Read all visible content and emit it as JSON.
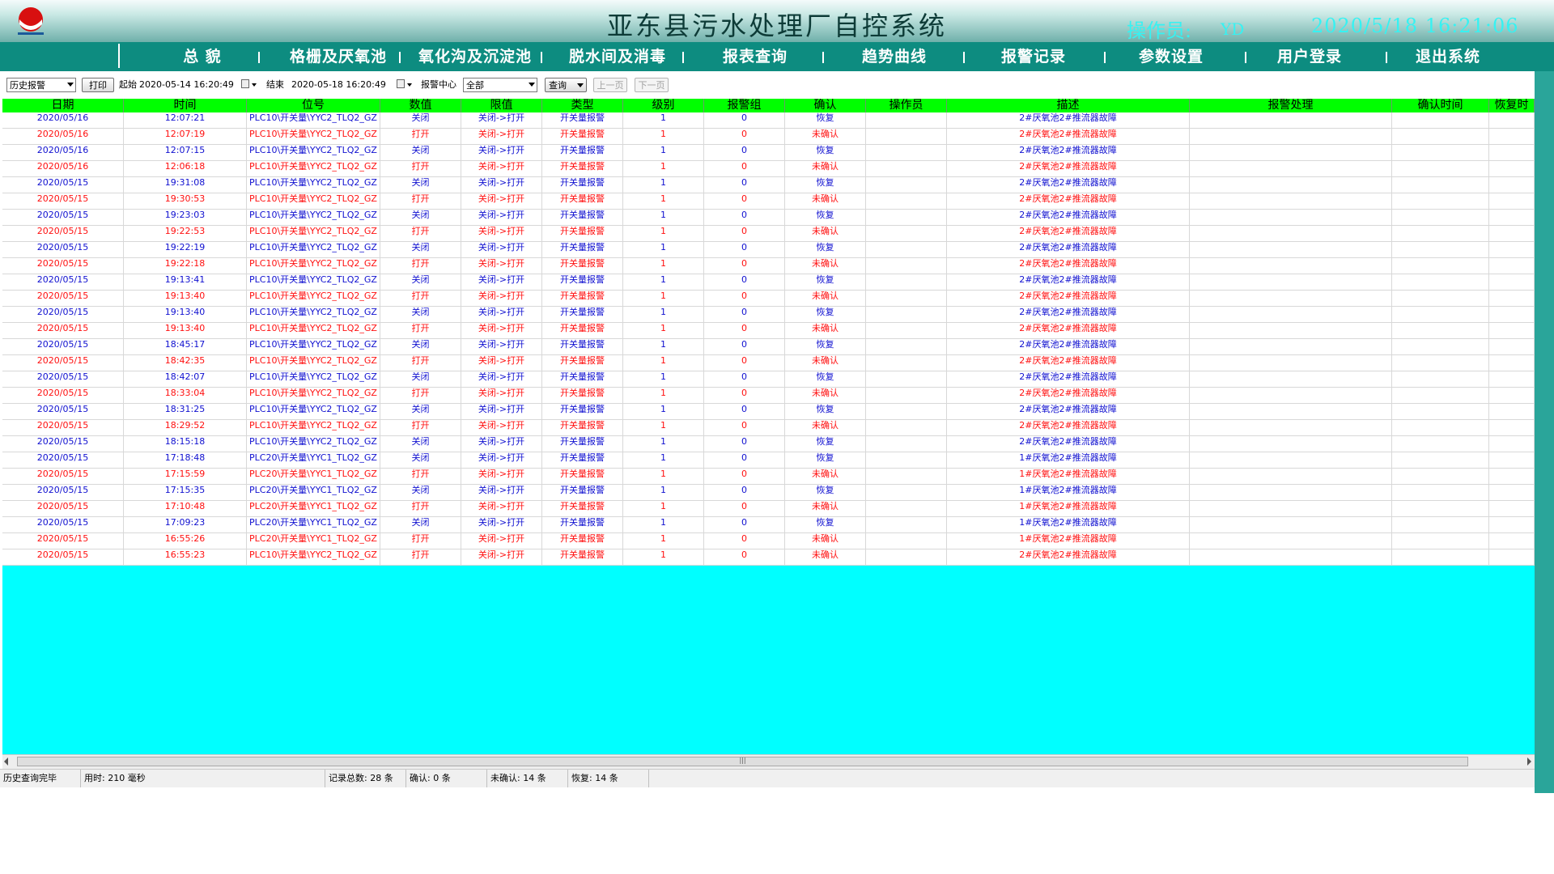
{
  "header": {
    "title": "亚东县污水处理厂自控系统",
    "operator_label": "操作员:",
    "operator": "YD",
    "datetime": "2020/5/18 16:21:06"
  },
  "nav": [
    {
      "label": "总  貌"
    },
    {
      "label": "格栅及厌氧池"
    },
    {
      "label": "氧化沟及沉淀池"
    },
    {
      "label": "脱水间及消毒"
    },
    {
      "label": "报表查询"
    },
    {
      "label": "趋势曲线"
    },
    {
      "label": "报警记录"
    },
    {
      "label": "参数设置"
    },
    {
      "label": "用户登录"
    },
    {
      "label": "退出系统"
    }
  ],
  "toolbar": {
    "mode": "历史报警",
    "print": "打印",
    "start_label": "起始",
    "start_value": "2020-05-14 16:20:49",
    "end_label": "结束",
    "end_value": "2020-05-18 16:20:49",
    "center_label": "报警中心",
    "center_value": "全部",
    "query": "查询",
    "prev": "上一页",
    "next": "下一页"
  },
  "table": {
    "headers": [
      "日期",
      "时间",
      "位号",
      "数值",
      "限值",
      "类型",
      "级别",
      "报警组",
      "确认",
      "操作员",
      "描述",
      "报警处理",
      "确认时间",
      "恢复时"
    ],
    "rows": [
      {
        "c": "blue",
        "d": "2020/05/16",
        "t": "12:07:21",
        "tag": "PLC10\\开关量\\YYC2_TLQ2_GZ",
        "v": "关闭",
        "lim": "关闭->打开",
        "type": "开关量报警",
        "lv": "1",
        "grp": "0",
        "ack": "恢复",
        "desc": "2#厌氧池2#推流器故障"
      },
      {
        "c": "red",
        "d": "2020/05/16",
        "t": "12:07:19",
        "tag": "PLC10\\开关量\\YYC2_TLQ2_GZ",
        "v": "打开",
        "lim": "关闭->打开",
        "type": "开关量报警",
        "lv": "1",
        "grp": "0",
        "ack": "未确认",
        "desc": "2#厌氧池2#推流器故障"
      },
      {
        "c": "blue",
        "d": "2020/05/16",
        "t": "12:07:15",
        "tag": "PLC10\\开关量\\YYC2_TLQ2_GZ",
        "v": "关闭",
        "lim": "关闭->打开",
        "type": "开关量报警",
        "lv": "1",
        "grp": "0",
        "ack": "恢复",
        "desc": "2#厌氧池2#推流器故障"
      },
      {
        "c": "red",
        "d": "2020/05/16",
        "t": "12:06:18",
        "tag": "PLC10\\开关量\\YYC2_TLQ2_GZ",
        "v": "打开",
        "lim": "关闭->打开",
        "type": "开关量报警",
        "lv": "1",
        "grp": "0",
        "ack": "未确认",
        "desc": "2#厌氧池2#推流器故障"
      },
      {
        "c": "blue",
        "d": "2020/05/15",
        "t": "19:31:08",
        "tag": "PLC10\\开关量\\YYC2_TLQ2_GZ",
        "v": "关闭",
        "lim": "关闭->打开",
        "type": "开关量报警",
        "lv": "1",
        "grp": "0",
        "ack": "恢复",
        "desc": "2#厌氧池2#推流器故障"
      },
      {
        "c": "red",
        "d": "2020/05/15",
        "t": "19:30:53",
        "tag": "PLC10\\开关量\\YYC2_TLQ2_GZ",
        "v": "打开",
        "lim": "关闭->打开",
        "type": "开关量报警",
        "lv": "1",
        "grp": "0",
        "ack": "未确认",
        "desc": "2#厌氧池2#推流器故障"
      },
      {
        "c": "blue",
        "d": "2020/05/15",
        "t": "19:23:03",
        "tag": "PLC10\\开关量\\YYC2_TLQ2_GZ",
        "v": "关闭",
        "lim": "关闭->打开",
        "type": "开关量报警",
        "lv": "1",
        "grp": "0",
        "ack": "恢复",
        "desc": "2#厌氧池2#推流器故障"
      },
      {
        "c": "red",
        "d": "2020/05/15",
        "t": "19:22:53",
        "tag": "PLC10\\开关量\\YYC2_TLQ2_GZ",
        "v": "打开",
        "lim": "关闭->打开",
        "type": "开关量报警",
        "lv": "1",
        "grp": "0",
        "ack": "未确认",
        "desc": "2#厌氧池2#推流器故障"
      },
      {
        "c": "blue",
        "d": "2020/05/15",
        "t": "19:22:19",
        "tag": "PLC10\\开关量\\YYC2_TLQ2_GZ",
        "v": "关闭",
        "lim": "关闭->打开",
        "type": "开关量报警",
        "lv": "1",
        "grp": "0",
        "ack": "恢复",
        "desc": "2#厌氧池2#推流器故障"
      },
      {
        "c": "red",
        "d": "2020/05/15",
        "t": "19:22:18",
        "tag": "PLC10\\开关量\\YYC2_TLQ2_GZ",
        "v": "打开",
        "lim": "关闭->打开",
        "type": "开关量报警",
        "lv": "1",
        "grp": "0",
        "ack": "未确认",
        "desc": "2#厌氧池2#推流器故障"
      },
      {
        "c": "blue",
        "d": "2020/05/15",
        "t": "19:13:41",
        "tag": "PLC10\\开关量\\YYC2_TLQ2_GZ",
        "v": "关闭",
        "lim": "关闭->打开",
        "type": "开关量报警",
        "lv": "1",
        "grp": "0",
        "ack": "恢复",
        "desc": "2#厌氧池2#推流器故障"
      },
      {
        "c": "red",
        "d": "2020/05/15",
        "t": "19:13:40",
        "tag": "PLC10\\开关量\\YYC2_TLQ2_GZ",
        "v": "打开",
        "lim": "关闭->打开",
        "type": "开关量报警",
        "lv": "1",
        "grp": "0",
        "ack": "未确认",
        "desc": "2#厌氧池2#推流器故障"
      },
      {
        "c": "blue",
        "d": "2020/05/15",
        "t": "19:13:40",
        "tag": "PLC10\\开关量\\YYC2_TLQ2_GZ",
        "v": "关闭",
        "lim": "关闭->打开",
        "type": "开关量报警",
        "lv": "1",
        "grp": "0",
        "ack": "恢复",
        "desc": "2#厌氧池2#推流器故障"
      },
      {
        "c": "red",
        "d": "2020/05/15",
        "t": "19:13:40",
        "tag": "PLC10\\开关量\\YYC2_TLQ2_GZ",
        "v": "打开",
        "lim": "关闭->打开",
        "type": "开关量报警",
        "lv": "1",
        "grp": "0",
        "ack": "未确认",
        "desc": "2#厌氧池2#推流器故障"
      },
      {
        "c": "blue",
        "d": "2020/05/15",
        "t": "18:45:17",
        "tag": "PLC10\\开关量\\YYC2_TLQ2_GZ",
        "v": "关闭",
        "lim": "关闭->打开",
        "type": "开关量报警",
        "lv": "1",
        "grp": "0",
        "ack": "恢复",
        "desc": "2#厌氧池2#推流器故障"
      },
      {
        "c": "red",
        "d": "2020/05/15",
        "t": "18:42:35",
        "tag": "PLC10\\开关量\\YYC2_TLQ2_GZ",
        "v": "打开",
        "lim": "关闭->打开",
        "type": "开关量报警",
        "lv": "1",
        "grp": "0",
        "ack": "未确认",
        "desc": "2#厌氧池2#推流器故障"
      },
      {
        "c": "blue",
        "d": "2020/05/15",
        "t": "18:42:07",
        "tag": "PLC10\\开关量\\YYC2_TLQ2_GZ",
        "v": "关闭",
        "lim": "关闭->打开",
        "type": "开关量报警",
        "lv": "1",
        "grp": "0",
        "ack": "恢复",
        "desc": "2#厌氧池2#推流器故障"
      },
      {
        "c": "red",
        "d": "2020/05/15",
        "t": "18:33:04",
        "tag": "PLC10\\开关量\\YYC2_TLQ2_GZ",
        "v": "打开",
        "lim": "关闭->打开",
        "type": "开关量报警",
        "lv": "1",
        "grp": "0",
        "ack": "未确认",
        "desc": "2#厌氧池2#推流器故障"
      },
      {
        "c": "blue",
        "d": "2020/05/15",
        "t": "18:31:25",
        "tag": "PLC10\\开关量\\YYC2_TLQ2_GZ",
        "v": "关闭",
        "lim": "关闭->打开",
        "type": "开关量报警",
        "lv": "1",
        "grp": "0",
        "ack": "恢复",
        "desc": "2#厌氧池2#推流器故障"
      },
      {
        "c": "red",
        "d": "2020/05/15",
        "t": "18:29:52",
        "tag": "PLC10\\开关量\\YYC2_TLQ2_GZ",
        "v": "打开",
        "lim": "关闭->打开",
        "type": "开关量报警",
        "lv": "1",
        "grp": "0",
        "ack": "未确认",
        "desc": "2#厌氧池2#推流器故障"
      },
      {
        "c": "blue",
        "d": "2020/05/15",
        "t": "18:15:18",
        "tag": "PLC10\\开关量\\YYC2_TLQ2_GZ",
        "v": "关闭",
        "lim": "关闭->打开",
        "type": "开关量报警",
        "lv": "1",
        "grp": "0",
        "ack": "恢复",
        "desc": "2#厌氧池2#推流器故障"
      },
      {
        "c": "blue",
        "d": "2020/05/15",
        "t": "17:18:48",
        "tag": "PLC20\\开关量\\YYC1_TLQ2_GZ",
        "v": "关闭",
        "lim": "关闭->打开",
        "type": "开关量报警",
        "lv": "1",
        "grp": "0",
        "ack": "恢复",
        "desc": "1#厌氧池2#推流器故障"
      },
      {
        "c": "red",
        "d": "2020/05/15",
        "t": "17:15:59",
        "tag": "PLC20\\开关量\\YYC1_TLQ2_GZ",
        "v": "打开",
        "lim": "关闭->打开",
        "type": "开关量报警",
        "lv": "1",
        "grp": "0",
        "ack": "未确认",
        "desc": "1#厌氧池2#推流器故障"
      },
      {
        "c": "blue",
        "d": "2020/05/15",
        "t": "17:15:35",
        "tag": "PLC20\\开关量\\YYC1_TLQ2_GZ",
        "v": "关闭",
        "lim": "关闭->打开",
        "type": "开关量报警",
        "lv": "1",
        "grp": "0",
        "ack": "恢复",
        "desc": "1#厌氧池2#推流器故障"
      },
      {
        "c": "red",
        "d": "2020/05/15",
        "t": "17:10:48",
        "tag": "PLC20\\开关量\\YYC1_TLQ2_GZ",
        "v": "打开",
        "lim": "关闭->打开",
        "type": "开关量报警",
        "lv": "1",
        "grp": "0",
        "ack": "未确认",
        "desc": "1#厌氧池2#推流器故障"
      },
      {
        "c": "blue",
        "d": "2020/05/15",
        "t": "17:09:23",
        "tag": "PLC20\\开关量\\YYC1_TLQ2_GZ",
        "v": "关闭",
        "lim": "关闭->打开",
        "type": "开关量报警",
        "lv": "1",
        "grp": "0",
        "ack": "恢复",
        "desc": "1#厌氧池2#推流器故障"
      },
      {
        "c": "red",
        "d": "2020/05/15",
        "t": "16:55:26",
        "tag": "PLC20\\开关量\\YYC1_TLQ2_GZ",
        "v": "打开",
        "lim": "关闭->打开",
        "type": "开关量报警",
        "lv": "1",
        "grp": "0",
        "ack": "未确认",
        "desc": "1#厌氧池2#推流器故障"
      },
      {
        "c": "red",
        "d": "2020/05/15",
        "t": "16:55:23",
        "tag": "PLC10\\开关量\\YYC2_TLQ2_GZ",
        "v": "打开",
        "lim": "关闭->打开",
        "type": "开关量报警",
        "lv": "1",
        "grp": "0",
        "ack": "未确认",
        "desc": "2#厌氧池2#推流器故障"
      }
    ]
  },
  "statusbar": {
    "state": "历史查询完毕",
    "elapsed": "用时: 210 毫秒",
    "total": "记录总数: 28 条",
    "acked": "确认: 0 条",
    "unacked": "未确认: 14 条",
    "recovered": "恢复: 14 条"
  },
  "colors": {
    "header_bar": "#0d8c80",
    "table_header": "#00ff00",
    "grid_bg": "#00ffff",
    "active_row": "#1010d0",
    "alarm_row": "#ff1010",
    "header_text": "#36f2f2"
  },
  "icons": {
    "logo": "company-logo-icon",
    "calendar": "calendar-dropdown-icon"
  }
}
